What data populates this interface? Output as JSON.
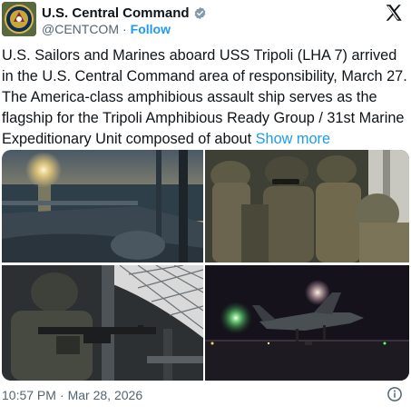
{
  "author": {
    "display_name": "U.S. Central Command",
    "handle": "@CENTCOM",
    "separator": "·",
    "follow_label": "Follow"
  },
  "post": {
    "text": "U.S. Sailors and Marines aboard USS Tripoli (LHA 7) arrived in the U.S. Central Command area of responsibility, March 27. The America-class amphibious assault ship serves as the flagship for the Tripoli Amphibious Ready Group / 31st Marine Expeditionary Unit composed of about ",
    "show_more_label": "Show more",
    "time": "10:57 PM",
    "dot": "·",
    "date": "Mar 28, 2026"
  },
  "media": [
    {
      "subject": "Sunset over ocean from ship deck"
    },
    {
      "subject": "Marines in combat gear"
    },
    {
      "subject": "Machine gunner on deck"
    },
    {
      "subject": "F-35 jet on flight deck at night"
    }
  ],
  "colors": {
    "link": "#1d9bf0",
    "secondary_text": "#536471",
    "text": "#0f1419"
  },
  "icons": [
    "verified-badge-icon",
    "x-logo-icon",
    "info-icon"
  ]
}
